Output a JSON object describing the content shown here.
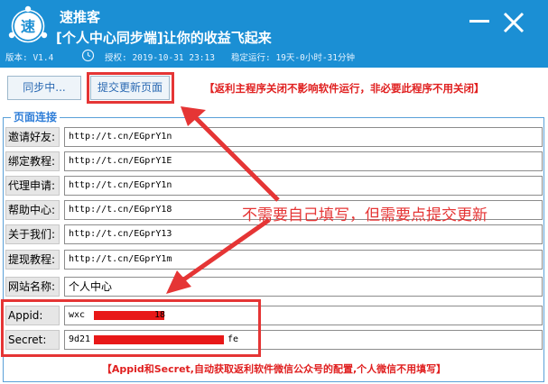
{
  "window": {
    "app_name": "速推客",
    "slogan": "[个人中心同步端]让你的收益飞起来",
    "version": "版本: V1.4",
    "license": "授权: 2019-10-31 23:13",
    "uptime": "稳定运行: 19天-0小时-31分钟",
    "logo_text": "速"
  },
  "toolbar": {
    "sync_label": "同步中...",
    "submit_label": "提交更新页面",
    "notice": "【返利主程序关闭不影响软件运行，非必要此程序不用关闭】"
  },
  "section": {
    "title": "页面连接",
    "rows": [
      {
        "label": "邀请好友:",
        "value": "http://t.cn/EGprY1n"
      },
      {
        "label": "绑定教程:",
        "value": "http://t.cn/EGprY1E"
      },
      {
        "label": "代理申请:",
        "value": "http://t.cn/EGprY1n"
      },
      {
        "label": "帮助中心:",
        "value": "http://t.cn/EGprY18"
      },
      {
        "label": "关于我们:",
        "value": "http://t.cn/EGprY13"
      },
      {
        "label": "提现教程:",
        "value": "http://t.cn/EGprY1m"
      },
      {
        "label": "网站名称:",
        "value": "个人中心"
      },
      {
        "label": "Appid:",
        "value_start": "wxc",
        "value_end": "18"
      },
      {
        "label": "Secret:",
        "value_start": "9d21",
        "value_end": "fe"
      }
    ]
  },
  "annotation": "不需要自己填写，但需要点提交更新",
  "bottom_notice": "【Appid和Secret,自动获取返利软件微信公众号的配置,个人微信不用填写】",
  "colors": {
    "titlebar": "#1b8fd4",
    "highlight": "#e53535",
    "notice": "#e02020",
    "group_border": "#5aa0d8"
  }
}
